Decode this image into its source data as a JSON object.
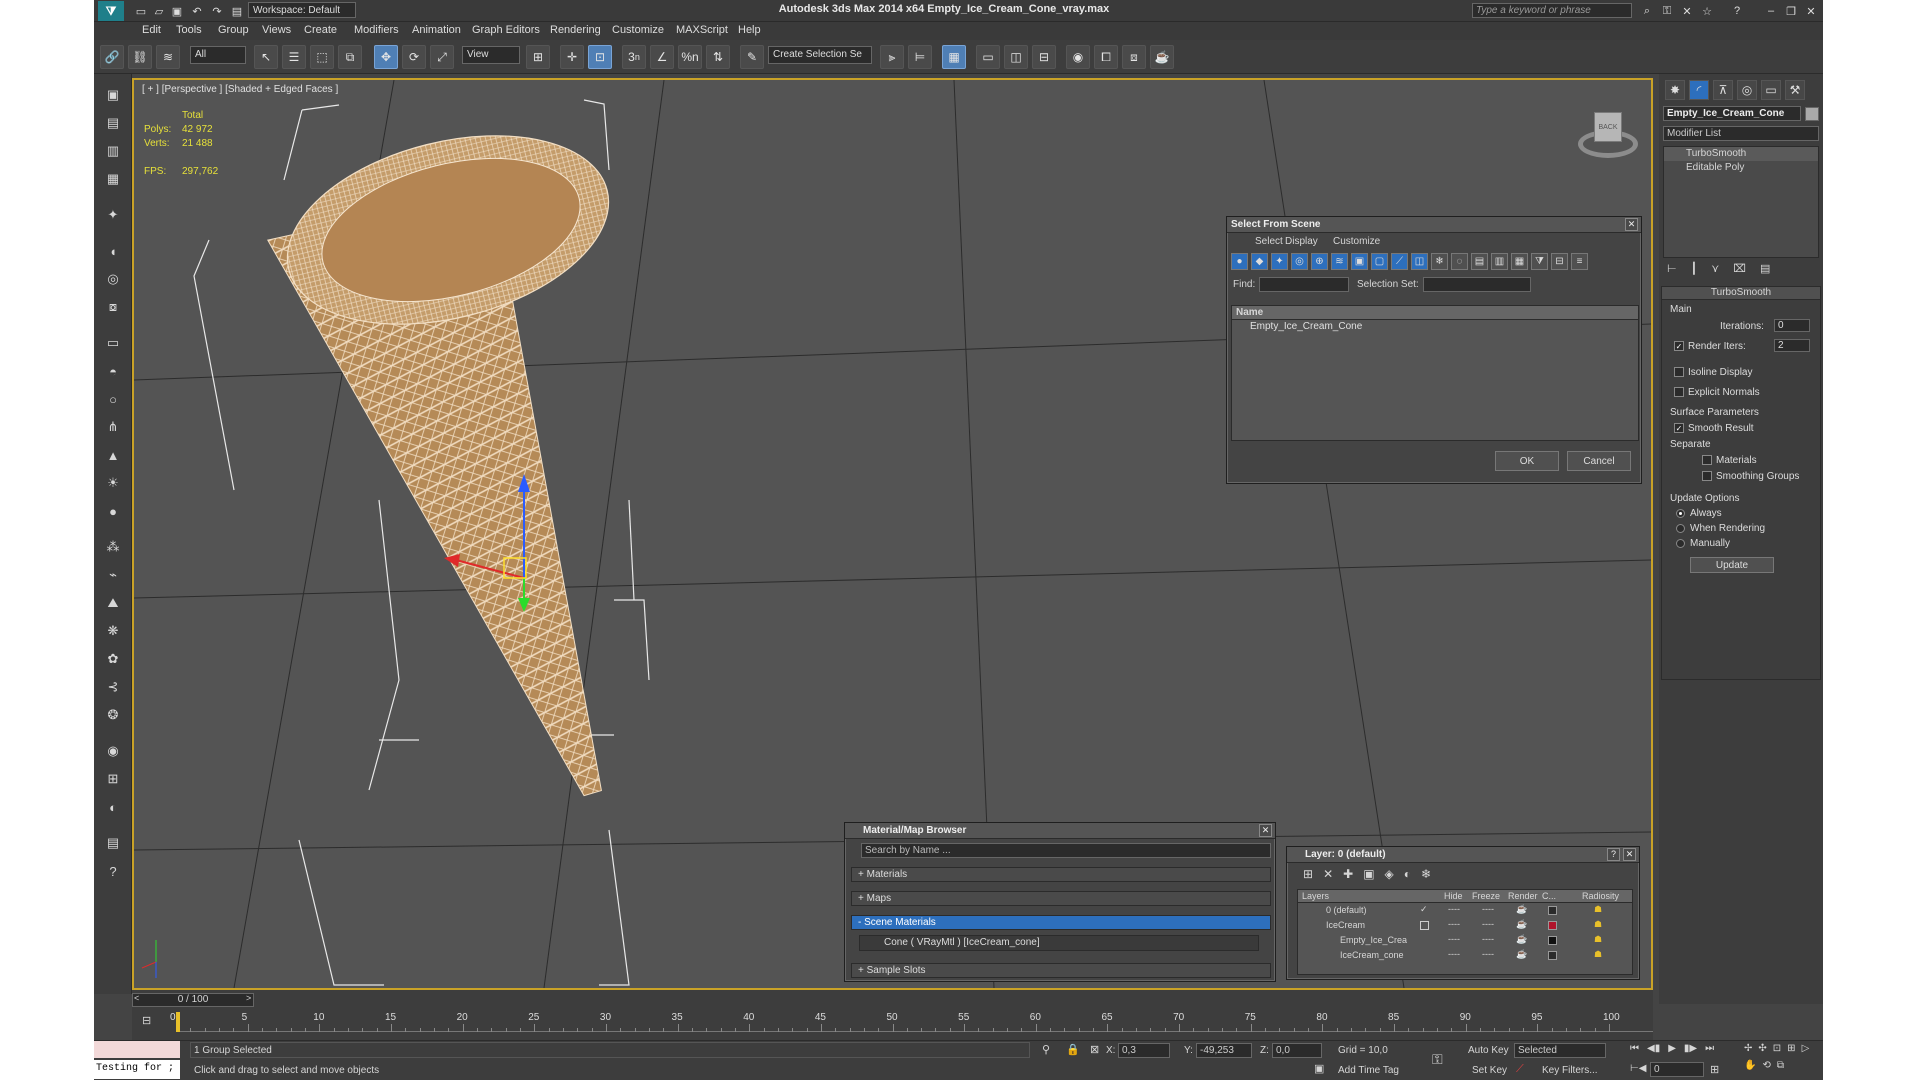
{
  "title": "Autodesk 3ds Max  2014 x64      Empty_Ice_Cream_Cone_vray.max",
  "workspace": "Workspace: Default",
  "search_placeholder": "Type a keyword or phrase",
  "menu": [
    "Edit",
    "Tools",
    "Group",
    "Views",
    "Create",
    "Modifiers",
    "Animation",
    "Graph Editors",
    "Rendering",
    "Customize",
    "MAXScript",
    "Help"
  ],
  "toolbar": {
    "filter": "All",
    "refcoord": "View",
    "selection_set": "Create Selection Se",
    "snap_3": "3",
    "snap_n": "n",
    "percent": "%n"
  },
  "viewport": {
    "label": "[ + ] [Perspective ] [Shaded + Edged Faces ]",
    "stats": {
      "total": "Total",
      "polys_label": "Polys:",
      "polys": "42 972",
      "verts_label": "Verts:",
      "verts": "21 488",
      "fps_label": "FPS:",
      "fps": "297,762"
    },
    "viewcube_label": "BACK"
  },
  "right_panel": {
    "object_name": "Empty_Ice_Cream_Cone",
    "modifier_list": "Modifier List",
    "stack": [
      "TurboSmooth",
      "Editable Poly"
    ],
    "rollout_title": "TurboSmooth",
    "main": "Main",
    "iterations_label": "Iterations:",
    "iterations": "0",
    "render_iters_label": "Render Iters:",
    "render_iters": "2",
    "isoline": "Isoline Display",
    "explicit": "Explicit Normals",
    "surface": "Surface Parameters",
    "smooth_result": "Smooth Result",
    "separate": "Separate",
    "materials": "Materials",
    "smoothing_groups": "Smoothing Groups",
    "update_options": "Update Options",
    "always": "Always",
    "when_rendering": "When Rendering",
    "manually": "Manually",
    "update_button": "Update"
  },
  "select_dialog": {
    "title": "Select From Scene",
    "menu": [
      "Select",
      "Display",
      "Customize"
    ],
    "find_label": "Find:",
    "selset_label": "Selection Set:",
    "column": "Name",
    "items": [
      "Empty_Ice_Cream_Cone"
    ],
    "ok": "OK",
    "cancel": "Cancel"
  },
  "material_browser": {
    "title": "Material/Map Browser",
    "search_placeholder": "Search by Name ...",
    "sections": [
      "+ Materials",
      "+ Maps",
      "- Scene Materials"
    ],
    "scene_item": "Cone  ( VRayMtl ) [IceCream_cone]",
    "sample_slots": "+ Sample Slots"
  },
  "layer_dialog": {
    "title": "Layer: 0 (default)",
    "columns": [
      "Layers",
      "Hide",
      "Freeze",
      "Render",
      "C...",
      "Radiosity"
    ],
    "rows": [
      {
        "name": "0 (default)",
        "color": "#2b2b2b"
      },
      {
        "name": "IceCream",
        "color": "#b0142b"
      },
      {
        "name": "Empty_Ice_Crea",
        "color": "#111111"
      },
      {
        "name": "IceCream_cone",
        "color": "#2b2b2b"
      }
    ],
    "dash": "----"
  },
  "timeline": {
    "frame_counter": "0 / 100",
    "ticks": [
      0,
      5,
      10,
      15,
      20,
      25,
      30,
      35,
      40,
      45,
      50,
      55,
      60,
      65,
      70,
      75,
      80,
      85,
      90,
      95,
      100
    ]
  },
  "status": {
    "script_box": "Testing for ;",
    "selection": "1 Group Selected",
    "prompt": "Click and drag to select and move objects",
    "x_label": "X:",
    "x": "0,3",
    "y_label": "Y:",
    "y": "-49,253",
    "z_label": "Z:",
    "z": "0,0",
    "grid": "Grid = 10,0",
    "add_time_tag": "Add Time Tag",
    "auto_key": "Auto Key",
    "selected": "Selected",
    "set_key": "Set Key",
    "key_filters": "Key Filters...",
    "frame": "0"
  },
  "colors": {
    "accent": "#c9a227",
    "highlight": "#2d6fbd",
    "cone": "#c39a64",
    "wire": "#f3dfc4"
  }
}
